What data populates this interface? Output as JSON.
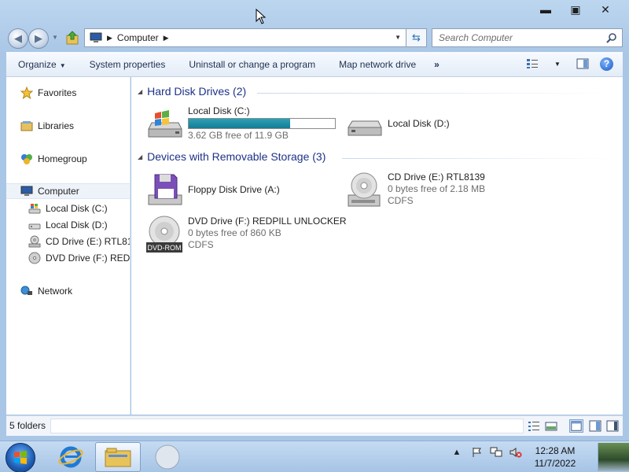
{
  "window": {
    "minimize": "▬",
    "maximize": "▣",
    "close": "✕"
  },
  "address_bar": {
    "crumbs": [
      "Computer"
    ],
    "search_placeholder": "Search Computer"
  },
  "command_bar": {
    "organize": "Organize",
    "system_properties": "System properties",
    "uninstall": "Uninstall or change a program",
    "map_drive": "Map network drive",
    "more": "»"
  },
  "nav_pane": {
    "favorites": "Favorites",
    "libraries": "Libraries",
    "homegroup": "Homegroup",
    "computer": "Computer",
    "computer_children": [
      {
        "label": "Local Disk (C:)",
        "icon": "windows-drive-icon"
      },
      {
        "label": "Local Disk (D:)",
        "icon": "hard-drive-icon"
      },
      {
        "label": "CD Drive (E:) RTL8139",
        "icon": "cd-drive-icon"
      },
      {
        "label": "DVD Drive (F:) REDPILL UNLOCKER",
        "icon": "dvd-drive-icon"
      }
    ],
    "network": "Network"
  },
  "content": {
    "groups": [
      {
        "title": "Hard Disk Drives (2)"
      },
      {
        "title": "Devices with Removable Storage (3)"
      }
    ],
    "hard_drives": [
      {
        "name": "Local Disk (C:)",
        "free": "3.62 GB free of 11.9 GB",
        "used_fraction": 0.696,
        "icon": "windows-drive-icon"
      },
      {
        "name": "Local Disk (D:)",
        "icon": "hard-drive-icon"
      }
    ],
    "removable": [
      {
        "name": "Floppy Disk Drive (A:)",
        "icon": "floppy-drive-icon"
      },
      {
        "name": "CD Drive (E:) RTL8139",
        "free": "0 bytes free of 2.18 MB",
        "fs": "CDFS",
        "icon": "cd-drive-icon"
      },
      {
        "name": "DVD Drive (F:) REDPILL UNLOCKER",
        "free": "0 bytes free of 860 KB",
        "fs": "CDFS",
        "badge": "DVD-ROM",
        "icon": "dvd-drive-icon"
      }
    ]
  },
  "status_bar": {
    "text": "5 folders"
  },
  "taskbar": {
    "time": "12:28 AM",
    "date": "11/7/2022"
  },
  "colors": {
    "progress_fill": "#1f8ea6",
    "group_header": "#1e3287",
    "taskbar": "#b9d1ec"
  }
}
